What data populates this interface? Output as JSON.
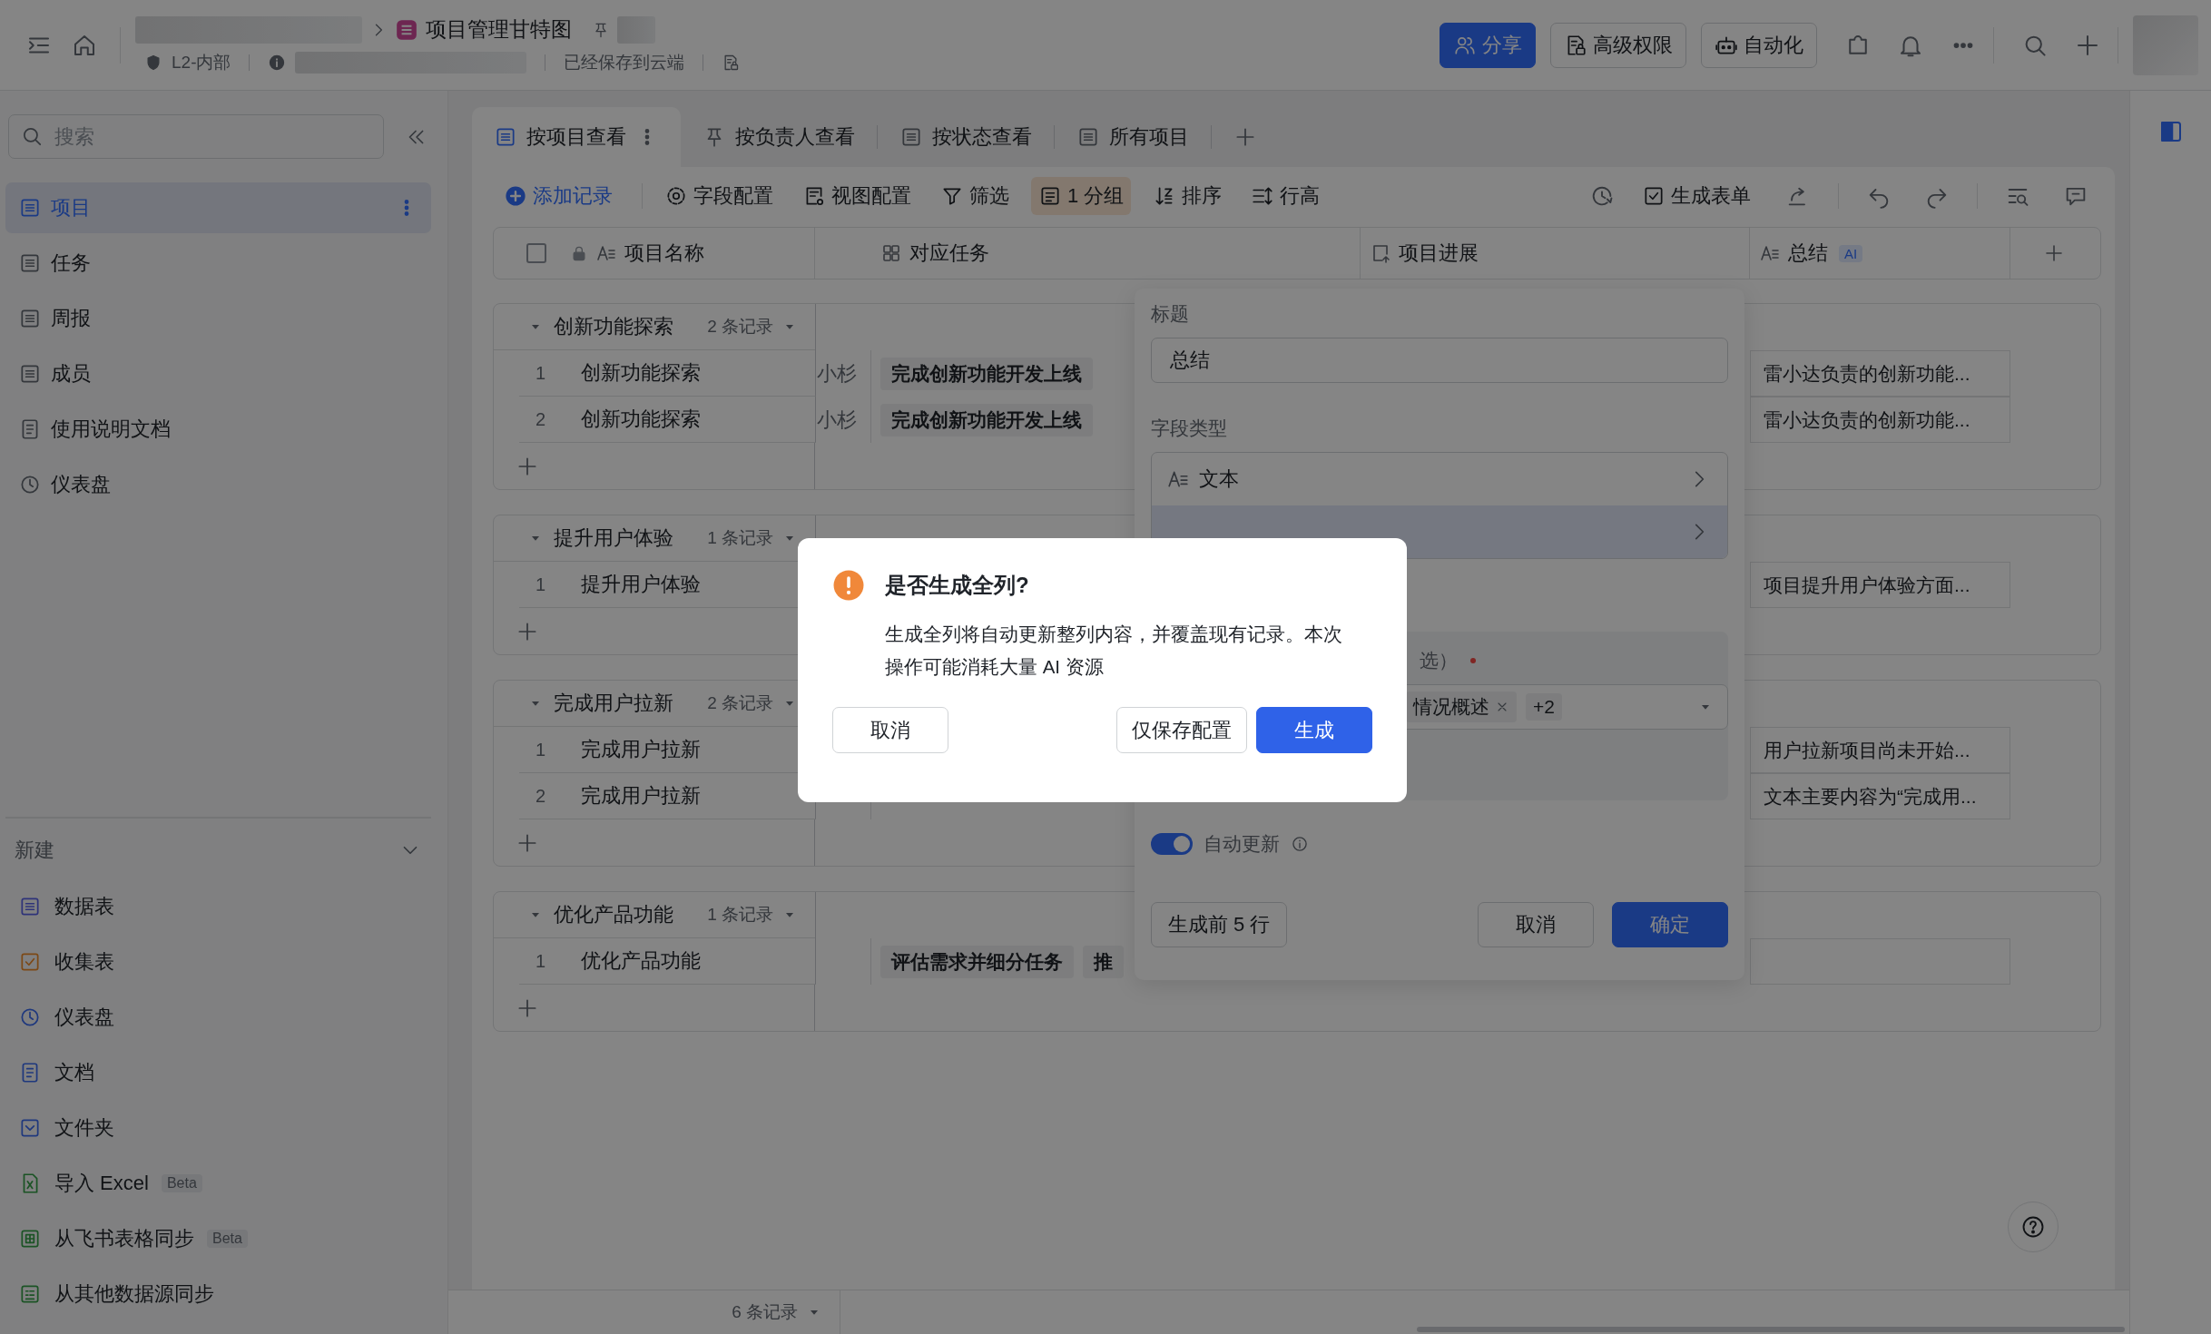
{
  "topbar": {
    "doc_title": "项目管理甘特图",
    "security_label": "L2-内部",
    "save_status": "已经保存到云端",
    "buttons": [
      {
        "label": "分享",
        "kind": "primary"
      },
      {
        "label": "高级权限",
        "kind": "default"
      },
      {
        "label": "自动化",
        "kind": "default"
      }
    ]
  },
  "sidebar": {
    "search": {
      "placeholder": "搜索"
    },
    "items": [
      {
        "label": "项目",
        "selected": true
      },
      {
        "label": "任务",
        "selected": false
      },
      {
        "label": "周报",
        "selected": false
      },
      {
        "label": "成员",
        "selected": false
      },
      {
        "label": "使用说明文档",
        "selected": false
      },
      {
        "label": "仪表盘",
        "selected": false
      }
    ],
    "new_section": {
      "title": "新建",
      "expanded": true,
      "items": [
        {
          "label": "数据表"
        },
        {
          "label": "收集表"
        },
        {
          "label": "仪表盘"
        },
        {
          "label": "文档"
        },
        {
          "label": "文件夹"
        },
        {
          "label": "导入 Excel",
          "badge": "Beta"
        },
        {
          "label": "从飞书表格同步",
          "badge": "Beta"
        },
        {
          "label": "从其他数据源同步"
        }
      ]
    }
  },
  "views": {
    "tabs": [
      {
        "label": "按项目查看",
        "selected": true
      },
      {
        "label": "按负责人查看",
        "selected": false
      },
      {
        "label": "按状态查看",
        "selected": false
      },
      {
        "label": "所有项目",
        "selected": false
      }
    ]
  },
  "toolbar": {
    "left": [
      {
        "label": "添加记录",
        "kind": "primary",
        "active": false
      },
      {
        "label": "字段配置",
        "kind": "plain",
        "active": false
      },
      {
        "label": "视图配置",
        "kind": "plain",
        "active": false
      },
      {
        "label": "筛选",
        "kind": "plain",
        "active": false
      },
      {
        "label": "1 分组",
        "kind": "plain",
        "active": true
      },
      {
        "label": "排序",
        "kind": "plain",
        "active": false
      },
      {
        "label": "行高",
        "kind": "plain",
        "active": false
      }
    ],
    "right": [
      {
        "label": "生成表单"
      }
    ]
  },
  "table": {
    "select_all_checked": false,
    "columns": [
      {
        "label": "项目名称",
        "locked": true
      },
      {
        "label": "对应任务",
        "locked": false
      },
      {
        "label": "项目进展",
        "locked": false
      },
      {
        "label": "总结",
        "locked": false,
        "badge": "AI"
      }
    ],
    "groups": [
      {
        "title": "创新功能探索",
        "count": "2 条记录",
        "expanded": true,
        "rows": [
          {
            "number": "1",
            "name": "创新功能探索",
            "owner": "小杉",
            "tasks": [
              "完成创新功能开发上线"
            ],
            "summary": "雷小达负责的创新功能..."
          },
          {
            "number": "2",
            "name": "创新功能探索",
            "owner": "小杉",
            "tasks": [
              "完成创新功能开发上线"
            ],
            "summary": "雷小达负责的创新功能..."
          }
        ]
      },
      {
        "title": "提升用户体验",
        "count": "1 条记录",
        "expanded": true,
        "rows": [
          {
            "number": "1",
            "name": "提升用户体验",
            "summary": "项目提升用户体验方面..."
          }
        ]
      },
      {
        "title": "完成用户拉新",
        "count": "2 条记录",
        "expanded": true,
        "rows": [
          {
            "number": "1",
            "name": "完成用户拉新",
            "summary": "用户拉新项目尚未开始..."
          },
          {
            "number": "2",
            "name": "完成用户拉新",
            "summary": "文本主要内容为“完成用..."
          }
        ]
      },
      {
        "title": "优化产品功能",
        "count": "1 条记录",
        "expanded": true,
        "rows": [
          {
            "number": "1",
            "name": "优化产品功能",
            "tasks": [
              "评估需求并细分任务",
              "推"
            ]
          }
        ]
      }
    ],
    "footer": {
      "record_count": "6 条记录"
    }
  },
  "field_panel": {
    "title_label": "标题",
    "title_value": "总结",
    "type_label": "字段类型",
    "type_value": "文本",
    "source_label": "选）",
    "required": true,
    "source_tags": [
      "情况概述"
    ],
    "more_count": "+2",
    "auto_update": {
      "label": "自动更新",
      "on": true
    },
    "buttons": [
      {
        "label": "生成前 5 行",
        "kind": "default"
      },
      {
        "label": "取消",
        "kind": "default"
      },
      {
        "label": "确定",
        "kind": "primary"
      }
    ]
  },
  "dialog": {
    "title": "是否生成全列?",
    "message": "生成全列将自动更新整列内容，并覆盖现有记录。本次操作可能消耗大量 AI 资源",
    "buttons": [
      {
        "label": "取消",
        "kind": "default"
      },
      {
        "label": "仅保存配置",
        "kind": "default"
      },
      {
        "label": "生成",
        "kind": "primary"
      }
    ]
  }
}
